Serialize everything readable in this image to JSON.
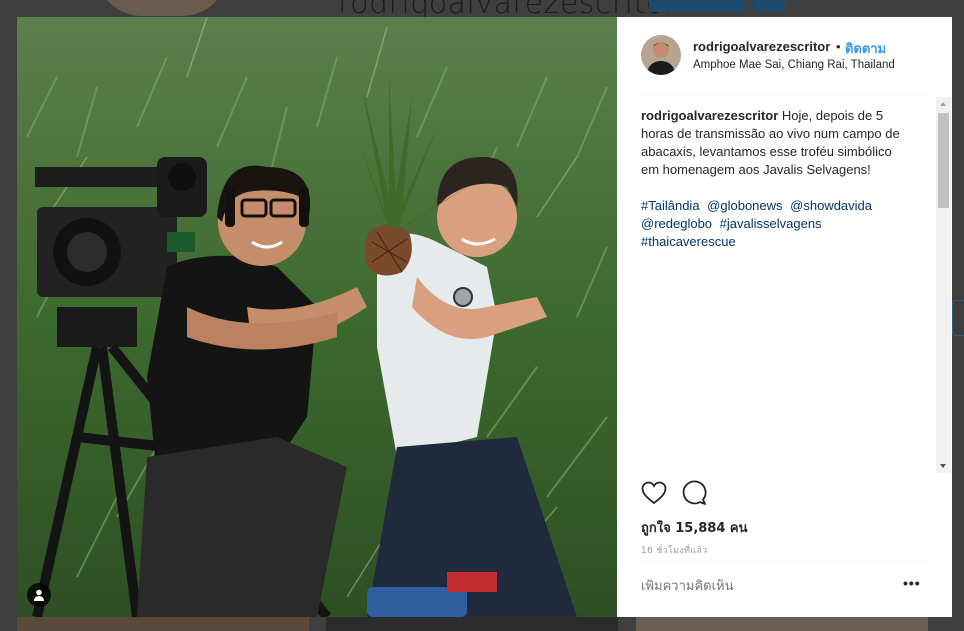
{
  "background": {
    "profile_title": "rodrigoalvarezescritor"
  },
  "post": {
    "author": {
      "username": "rodrigoalvarezescritor",
      "separator": "•",
      "follow_label": "ติดตาม",
      "location": "Amphoe Mae Sai, Chiang Rai, Thailand"
    },
    "caption": {
      "username": "rodrigoalvarezescritor",
      "text": "Hoje, depois de 5 horas de transmissão ao vivo num campo de abacaxis, levantamos esse troféu simbólico em homenagem aos Javalis Selvagens!",
      "hashtags": [
        "#Tailândia",
        "@globonews",
        "@showdavida",
        "@redeglobo",
        "#javalisselvagens",
        "#thaicaverescue"
      ]
    },
    "likes_text": "ถูกใจ 15,884 คน",
    "time_ago": "16 ชั่วโมงที่แล้ว",
    "comment_placeholder": "เพิ่มความคิดเห็น",
    "more_glyph": "•••",
    "icons": {
      "like": "heart-icon",
      "comment": "comment-icon",
      "tag": "person-tag-icon",
      "more": "more-options-icon"
    }
  },
  "colors": {
    "link_blue": "#3897f0",
    "hashtag": "#003569",
    "text": "#262626"
  }
}
